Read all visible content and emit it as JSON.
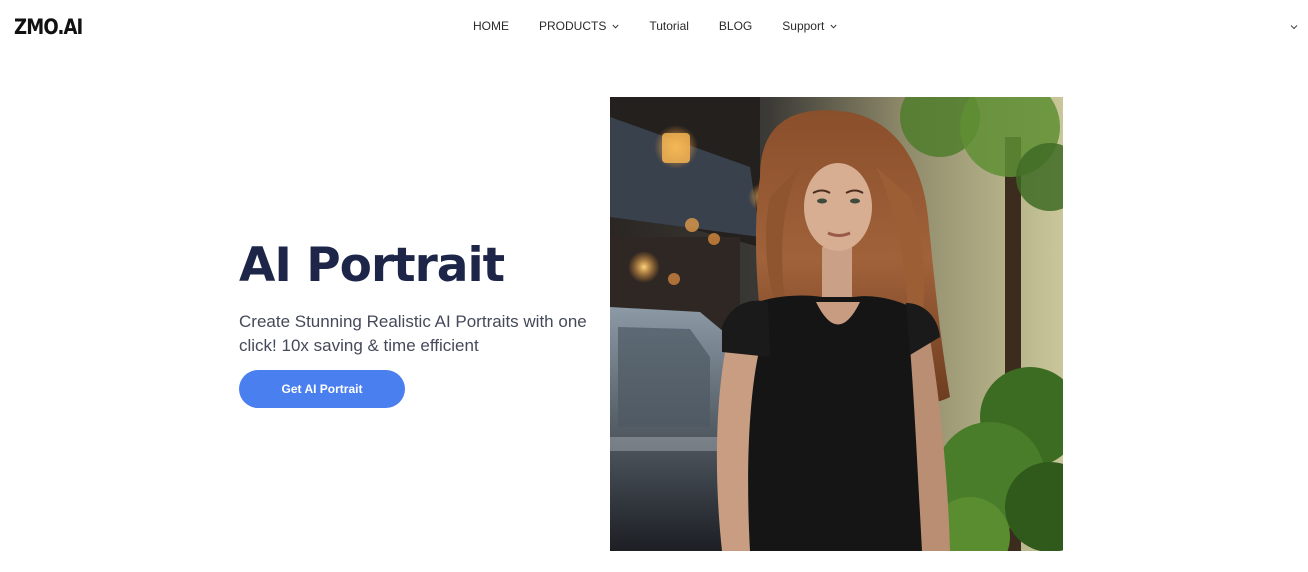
{
  "header": {
    "logo": "ZMO.AI",
    "nav": [
      {
        "label": "HOME",
        "has_dropdown": false
      },
      {
        "label": "PRODUCTS",
        "has_dropdown": true
      },
      {
        "label": "Tutorial",
        "has_dropdown": false
      },
      {
        "label": "BLOG",
        "has_dropdown": false
      },
      {
        "label": "Support",
        "has_dropdown": true
      }
    ]
  },
  "hero": {
    "title": "AI Portrait",
    "subtitle": "Create Stunning Realistic AI Portraits with one click! 10x saving & time efficient",
    "cta_label": "Get AI Portrait",
    "image_subject": "ai-generated-portrait-photo"
  },
  "colors": {
    "accent": "#4a7ff0",
    "title": "#1d2548",
    "body_text": "#454a5a"
  }
}
